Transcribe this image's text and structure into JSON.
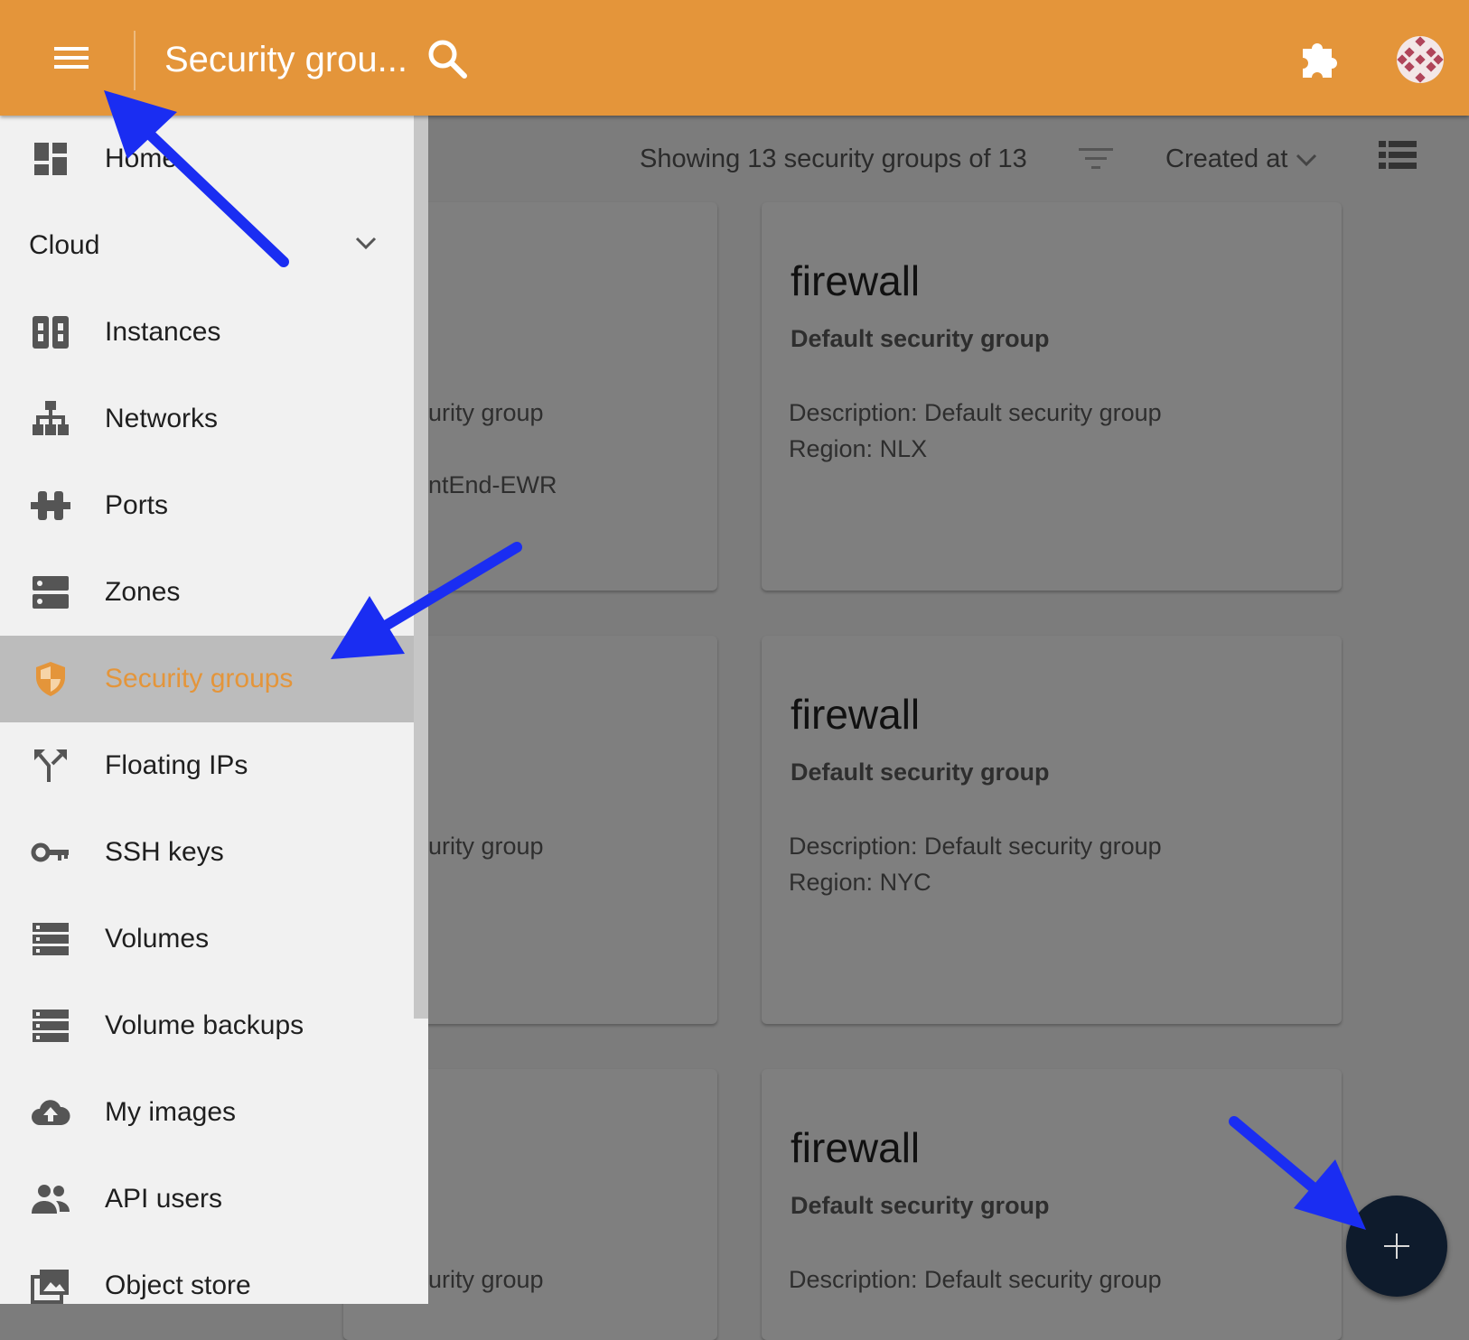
{
  "header": {
    "title": "Security grou...",
    "bg_color": "#e4953a"
  },
  "toolbar": {
    "count_text": "Showing 13 security groups of 13",
    "sort_label": "Created at"
  },
  "sidebar": {
    "home_label": "Home",
    "section_label": "Cloud",
    "items": [
      {
        "label": "Instances",
        "icon": "instances-icon"
      },
      {
        "label": "Networks",
        "icon": "network-icon"
      },
      {
        "label": "Ports",
        "icon": "ports-icon"
      },
      {
        "label": "Zones",
        "icon": "zones-icon"
      },
      {
        "label": "Security groups",
        "icon": "shield-icon",
        "active": true
      },
      {
        "label": "Floating IPs",
        "icon": "floating-ip-icon"
      },
      {
        "label": "SSH keys",
        "icon": "key-icon"
      },
      {
        "label": "Volumes",
        "icon": "volumes-icon"
      },
      {
        "label": "Volume backups",
        "icon": "volume-backups-icon"
      },
      {
        "label": "My images",
        "icon": "cloud-upload-icon"
      },
      {
        "label": "API users",
        "icon": "users-icon"
      },
      {
        "label": "Object store",
        "icon": "object-store-icon"
      }
    ],
    "active_color": "#e4953a"
  },
  "cards_left_partial": [
    {
      "line1": "urity group",
      "line2": "ntEnd-EWR"
    },
    {
      "line1": "urity group"
    },
    {
      "line1": "urity group"
    }
  ],
  "cards": [
    {
      "title": "firewall",
      "subtitle": "Default security group",
      "description": "Description: Default security group",
      "region": "Region: NLX"
    },
    {
      "title": "firewall",
      "subtitle": "Default security group",
      "description": "Description: Default security group",
      "region": "Region: NYC"
    },
    {
      "title": "firewall",
      "subtitle": "Default security group",
      "description": "Description: Default security group"
    }
  ],
  "annotation_color": "#1a2df2",
  "fab_color": "#0e1b2c"
}
